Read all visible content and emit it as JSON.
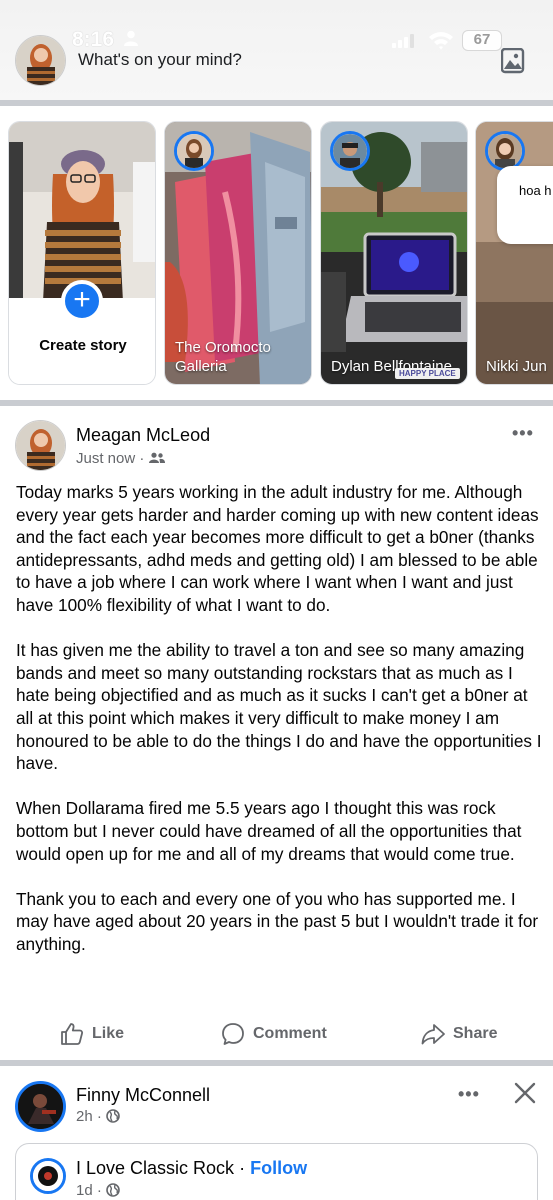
{
  "status_bar": {
    "time": "8:16",
    "battery": "67"
  },
  "composer": {
    "prompt": "What's on your mind?"
  },
  "stories": [
    {
      "label": "Create story"
    },
    {
      "label": "The Oromocto Galleria"
    },
    {
      "label": "Dylan Bellfontaine",
      "sticker": "HAPPY PLACE"
    },
    {
      "label": "Nikki Jun",
      "bubble": "hoa h hoa"
    }
  ],
  "post": {
    "author": "Meagan McLeod",
    "time": "Just now",
    "paragraphs": [
      "Today marks 5 years working in the adult industry for me. Although every year gets harder and harder coming up with new content ideas and the fact each year becomes more difficult to get a b0ner (thanks antidepressants, adhd meds and getting old) I am blessed to be able to have a job where I can work where I want when I want and just have 100% flexibility of what I want to do.",
      "It has given me the ability to travel a ton and see so many amazing bands and meet so many outstanding rockstars that as much as I hate being objectified and as much as it sucks I can't get a b0ner at all at this point which makes it very difficult to make money I am honoured to be able to do the things I do and have the opportunities I have.",
      "When Dollarama fired me 5.5 years ago I thought this was rock bottom but I never could have dreamed of all the opportunities that would open up for me and all of my dreams that would come true.",
      "Thank you to each and every one of you who has supported me. I may have aged about 20 years in the past 5 but I wouldn't trade it for anything."
    ],
    "actions": {
      "like": "Like",
      "comment": "Comment",
      "share": "Share"
    }
  },
  "next_post": {
    "author": "Finny McConnell",
    "time": "2h",
    "shared_page": {
      "name": "I Love Classic Rock",
      "separator": "·",
      "follow": "Follow",
      "time": "1d"
    }
  },
  "colors": {
    "accent": "#1877f2",
    "secondary_text": "#65676b",
    "divider": "#c9ccd1"
  }
}
